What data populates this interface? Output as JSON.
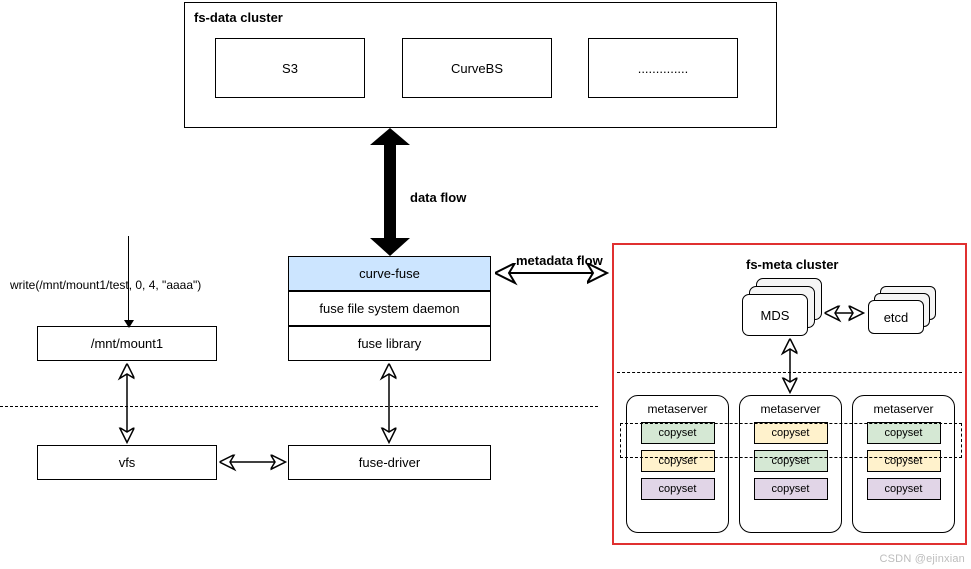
{
  "fs_data": {
    "title": "fs-data cluster",
    "s3": "S3",
    "curvebs": "CurveBS",
    "dots": ".............."
  },
  "flows": {
    "data": "data flow",
    "metadata": "metadata flow"
  },
  "stack": {
    "curve_fuse": "curve-fuse",
    "fuse_daemon": "fuse file system daemon",
    "fuse_lib": "fuse library"
  },
  "left": {
    "write_call": "write(/mnt/mount1/test, 0, 4, \"aaaa\")",
    "mount": "/mnt/mount1",
    "vfs": "vfs",
    "fuse_driver": "fuse-driver"
  },
  "fs_meta": {
    "title": "fs-meta  cluster",
    "mds": "MDS",
    "etcd": "etcd",
    "metaserver": "metaserver",
    "copyset": "copyset"
  },
  "watermark": "CSDN @ejinxian"
}
